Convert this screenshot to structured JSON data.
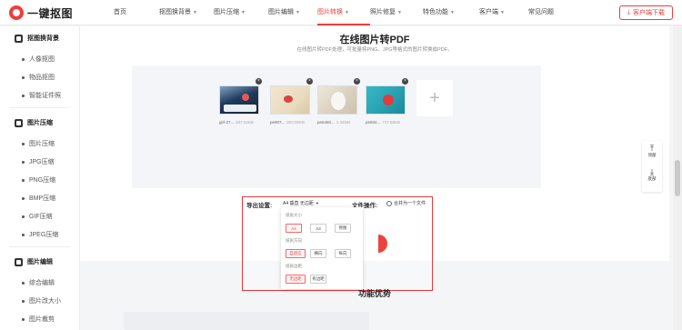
{
  "app": {
    "logo_text": "一键抠图"
  },
  "nav": {
    "items": [
      {
        "label": "首页",
        "has_dropdown": false
      },
      {
        "label": "抠图换背景",
        "has_dropdown": true
      },
      {
        "label": "图片压缩",
        "has_dropdown": true
      },
      {
        "label": "图片编辑",
        "has_dropdown": true
      },
      {
        "label": "图片转换",
        "has_dropdown": true,
        "active": true
      },
      {
        "label": "照片修复",
        "has_dropdown": true
      },
      {
        "label": "特色功能",
        "has_dropdown": true
      },
      {
        "label": "客户端",
        "has_dropdown": true
      },
      {
        "label": "常见问题",
        "has_dropdown": false
      }
    ],
    "download_label": "客户端下载"
  },
  "sidebar": {
    "sections": [
      {
        "title": "抠图换背景",
        "items": [
          "人像抠图",
          "物品抠图",
          "智能证件照"
        ]
      },
      {
        "title": "图片压缩",
        "items": [
          "图片压缩",
          "JPG压缩",
          "PNG压缩",
          "BMP压缩",
          "GIF压缩",
          "JPEG压缩"
        ]
      },
      {
        "title": "图片编辑",
        "items": [
          "综合编辑",
          "图片改大小",
          "图片裁剪"
        ]
      }
    ]
  },
  "main": {
    "title": "在线图片转PDF",
    "subtitle": "在线图片转PDF处理，可批量将PNG、JPG等格式的图片转换成PDF。",
    "files": [
      {
        "name": "girl-27...",
        "size": "937.52KB"
      },
      {
        "name": "pe907...",
        "size": "900.06KB"
      },
      {
        "name": "pe5450...",
        "size": "1.34MB"
      },
      {
        "name": "pe934...",
        "size": "747.86KB"
      }
    ],
    "add_symbol": "+",
    "output": {
      "label": "导出设置:",
      "selected_summary": "A4 垂直 无边距",
      "file_op_label": "文件操作:",
      "merge_label": "合并为一个文件",
      "paper_size": {
        "heading": "纸张大小",
        "options": [
          "A4",
          "A3",
          "原图"
        ],
        "selected": "A4"
      },
      "orientation": {
        "heading": "纸张方向",
        "options": [
          "自适应",
          "横向",
          "纵向"
        ],
        "selected": "自适应"
      },
      "margin": {
        "heading": "纸张边距",
        "options": [
          "无边距",
          "有边距"
        ],
        "selected": "无边距"
      }
    },
    "feature_title": "功能优势"
  },
  "float_tools": {
    "top_label": "顶部",
    "bottom_label": "底部"
  }
}
